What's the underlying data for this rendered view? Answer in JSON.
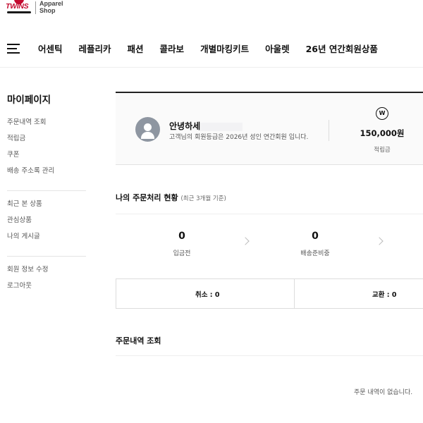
{
  "header": {
    "logo_word": "TWINS",
    "logo_text_line1": "Apparel",
    "logo_text_line2": "Shop",
    "nav": [
      "어센틱",
      "레플리카",
      "패션",
      "콜라보",
      "개별마킹키트",
      "아울렛",
      "26년 연간회원상품"
    ]
  },
  "sidebar": {
    "title": "마이페이지",
    "groups": [
      [
        "주문내역 조회",
        "적립금",
        "쿠폰",
        "배송 주소록 관리"
      ],
      [
        "최근 본 상품",
        "관심상품",
        "나의 게시글"
      ],
      [
        "회원 정보 수정",
        "로그아웃"
      ]
    ]
  },
  "profile": {
    "greeting": "안녕하세",
    "grade_text": "고객님의 회원등급은 2026년 성인 연간회원 입니다.",
    "points_icon": "W",
    "points_value": "150,000원",
    "points_label": "적립금"
  },
  "status": {
    "title": "나의 주문처리 현황",
    "subtitle": "(최근 3개월 기준)",
    "items": [
      {
        "count": "0",
        "label": "입금전"
      },
      {
        "count": "0",
        "label": "배송준비중"
      }
    ],
    "cancel_label": "취소 : 0",
    "exchange_label": "교환 : 0"
  },
  "orders": {
    "title": "주문내역 조회",
    "empty_message": "주문 내역이 없습니다."
  }
}
